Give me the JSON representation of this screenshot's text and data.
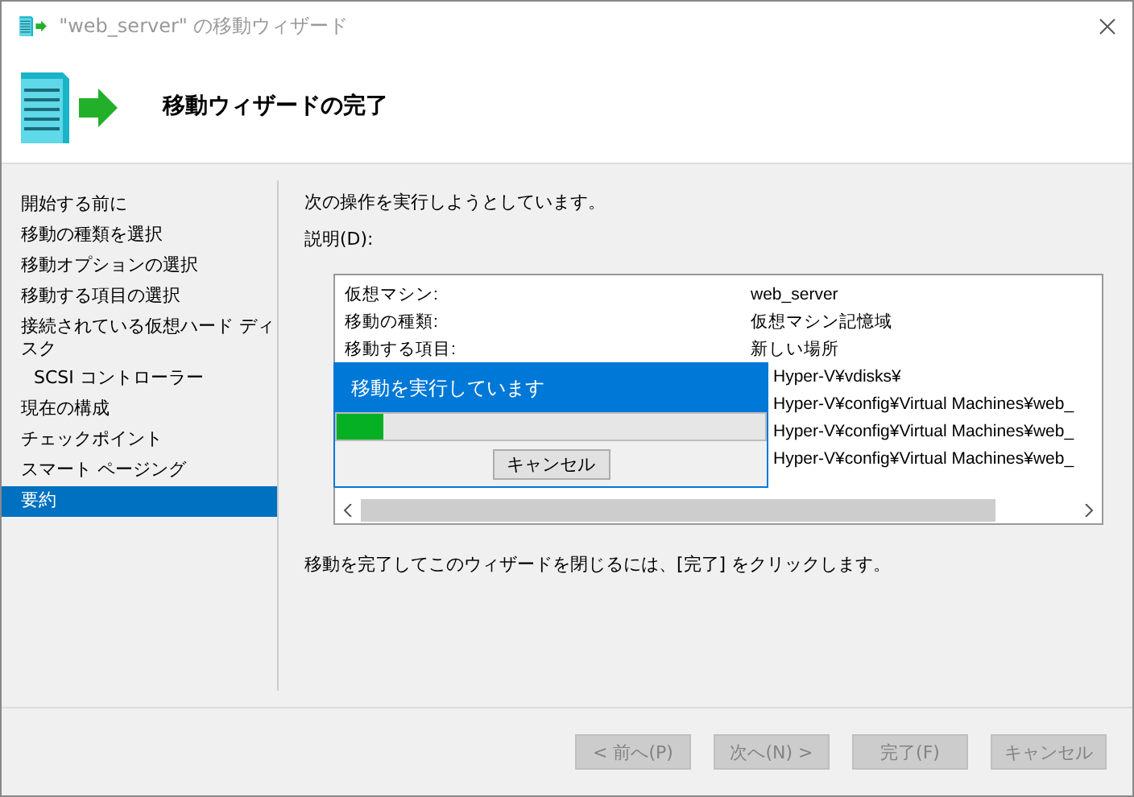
{
  "window": {
    "title": "\"web_server\" の移動ウィザード"
  },
  "header": {
    "title": "移動ウィザードの完了"
  },
  "sidebar": {
    "items": [
      {
        "label": "開始する前に",
        "selected": false,
        "sub": false
      },
      {
        "label": "移動の種類を選択",
        "selected": false,
        "sub": false
      },
      {
        "label": "移動オプションの選択",
        "selected": false,
        "sub": false
      },
      {
        "label": "移動する項目の選択",
        "selected": false,
        "sub": false
      },
      {
        "label": "接続されている仮想ハード ディスク",
        "selected": false,
        "sub": false
      },
      {
        "label": "SCSI コントローラー",
        "selected": false,
        "sub": true
      },
      {
        "label": "現在の構成",
        "selected": false,
        "sub": false
      },
      {
        "label": "チェックポイント",
        "selected": false,
        "sub": false
      },
      {
        "label": "スマート ページング",
        "selected": false,
        "sub": false
      },
      {
        "label": "要約",
        "selected": true,
        "sub": false
      }
    ]
  },
  "intro": "次の操作を実行しようとしています。",
  "description_label": "説明(D):",
  "summary_rows": [
    {
      "label": "仮想マシン:",
      "value": "web_server"
    },
    {
      "label": "移動の種類:",
      "value": "仮想マシン記憶域"
    },
    {
      "label": "移動する項目:",
      "value": "新しい場所"
    },
    {
      "value": "Hyper-V¥vdisks¥"
    },
    {
      "value": "Hyper-V¥config¥Virtual Machines¥web_"
    },
    {
      "value": "Hyper-V¥config¥Virtual Machines¥web_"
    },
    {
      "value": "Hyper-V¥config¥Virtual Machines¥web_"
    }
  ],
  "progress_dialog": {
    "title": "移動を実行しています",
    "level": 0.11,
    "cancel": "キャンセル"
  },
  "footer_text": "移動を完了してこのウィザードを閉じるには、[完了] をクリックします。",
  "buttons": [
    {
      "label": "< 前へ(P)",
      "disabled": true
    },
    {
      "label": "次へ(N) >",
      "disabled": true
    },
    {
      "label": "完了(F)",
      "disabled": true
    },
    {
      "label": "キャンセル",
      "disabled": true
    }
  ]
}
